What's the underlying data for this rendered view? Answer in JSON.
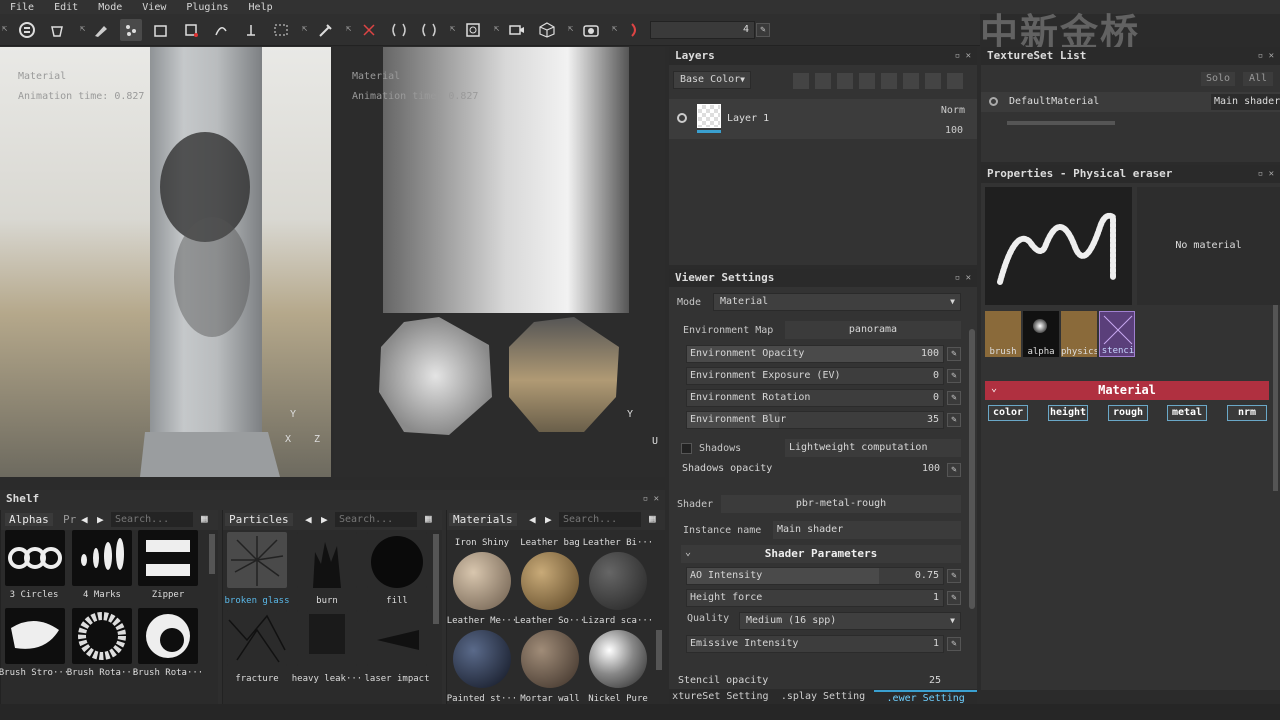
{
  "menu": [
    "File",
    "Edit",
    "Mode",
    "View",
    "Plugins",
    "Help"
  ],
  "toolbar": {
    "brush_size": "4"
  },
  "watermark": "中新金桥",
  "viewport_3d": {
    "mode": "Material",
    "anim": "Animation time: 0.827"
  },
  "viewport_2d": {
    "mode": "Material",
    "anim": "Animation time: 0.827"
  },
  "layers": {
    "title": "Layers",
    "channel": "Base Color",
    "layer_name": "Layer 1",
    "blend": "Norm",
    "opacity": "100"
  },
  "viewer": {
    "title": "Viewer Settings",
    "mode_label": "Mode",
    "mode_value": "Material",
    "env_map_label": "Environment Map",
    "env_map_value": "panorama",
    "env_opacity_label": "Environment Opacity",
    "env_opacity": "100",
    "env_opacity_level": 1.0,
    "env_exposure_label": "Environment Exposure (EV)",
    "env_exposure": "0",
    "env_rotation_label": "Environment Rotation",
    "env_rotation": "0",
    "env_blur_label": "Environment Blur",
    "env_blur": "35",
    "shadows_label": "Shadows",
    "shadows_mode": "Lightweight computation",
    "shadows_opacity_label": "Shadows opacity",
    "shadows_opacity": "100",
    "shader_label": "Shader",
    "shader_value": "pbr-metal-rough",
    "instance_label": "Instance name",
    "instance_value": "Main shader",
    "shader_params": "Shader Parameters",
    "ao_label": "AO Intensity",
    "ao_value": "0.75",
    "height_label": "Height force",
    "height_value": "1",
    "quality_label": "Quality",
    "quality_value": "Medium (16 spp)",
    "emissive_label": "Emissive Intensity",
    "emissive_value": "1",
    "stencil_label": "Stencil opacity",
    "stencil_value": "25"
  },
  "bottom_tabs": [
    "xtureSet Setting",
    ".splay Setting",
    ".ewer Setting"
  ],
  "texset": {
    "title": "TextureSet List",
    "solo": "Solo",
    "all": "All",
    "item": "DefaultMaterial",
    "shader": "Main shader"
  },
  "props": {
    "title": "Properties - Physical eraser",
    "no_material": "No material",
    "slots": [
      "brush",
      "alpha",
      "physics",
      "stenci"
    ],
    "material_header": "Material",
    "chips": [
      "color",
      "height",
      "rough",
      "metal",
      "nrm"
    ]
  },
  "shelf": {
    "title": "Shelf",
    "tab_alphas": "Alphas",
    "tab_pr": "Pr",
    "search_placeholder": "Search...",
    "alphas": [
      "3 Circles",
      "4 Marks",
      "Zipper",
      "Brush Stro···",
      "Brush Rota···",
      "Brush Rota···"
    ],
    "particles_title": "Particles",
    "particles": [
      "broken glass",
      "burn",
      "fill",
      "fracture",
      "heavy leak···",
      "laser impact"
    ],
    "materials_title": "Materials",
    "materials": [
      "Iron Shiny",
      "Leather bag",
      "Leather Bi···",
      "Leather Me···",
      "Leather So···",
      "Lizard sca···",
      "Painted st···",
      "Mortar wall",
      "Nickel Pure"
    ]
  },
  "colors": {
    "accent": "#b03040",
    "selected": "#5ab8e8"
  }
}
